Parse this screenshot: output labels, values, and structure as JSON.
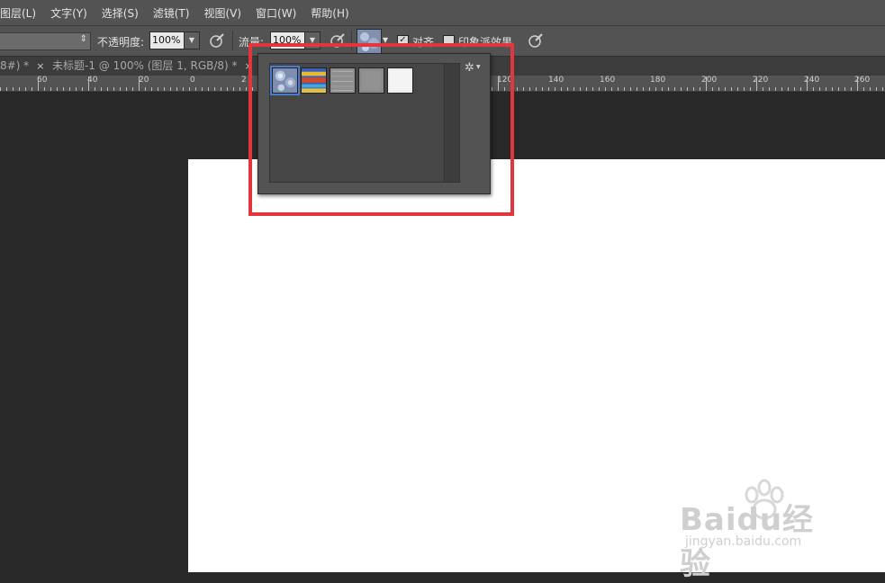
{
  "menu": {
    "items": [
      "图层(L)",
      "文字(Y)",
      "选择(S)",
      "滤镜(T)",
      "视图(V)",
      "窗口(W)",
      "帮助(H)"
    ]
  },
  "options": {
    "opacity_label": "不透明度:",
    "opacity_value": "100%",
    "flow_label": "流量:",
    "flow_value": "100%",
    "align_label": "对齐",
    "align_checked": true,
    "impressionist_label": "印象派效果",
    "impressionist_checked": false
  },
  "tabs": [
    {
      "label": "8#) *",
      "close": "×"
    },
    {
      "label": "未标题-1 @ 100% (图层 1, RGB/8) *",
      "close": "×"
    }
  ],
  "ruler": {
    "labels": [
      "60",
      "40",
      "20",
      "0",
      "2",
      "120",
      "140",
      "160",
      "180",
      "200",
      "220",
      "240",
      "260"
    ]
  },
  "pattern_picker": {
    "patterns": [
      "bubbles",
      "tie-dye",
      "gray-granite",
      "gray-texture",
      "light-fabric"
    ],
    "selected": "bubbles",
    "gear_icon": "gear-icon"
  },
  "colors": {
    "highlight": "#e3363c",
    "canvas": "#ffffff",
    "workspace": "#282828",
    "panel": "#535353"
  },
  "watermark": {
    "brand": "Baidu经验",
    "url": "jingyan.baidu.com"
  }
}
